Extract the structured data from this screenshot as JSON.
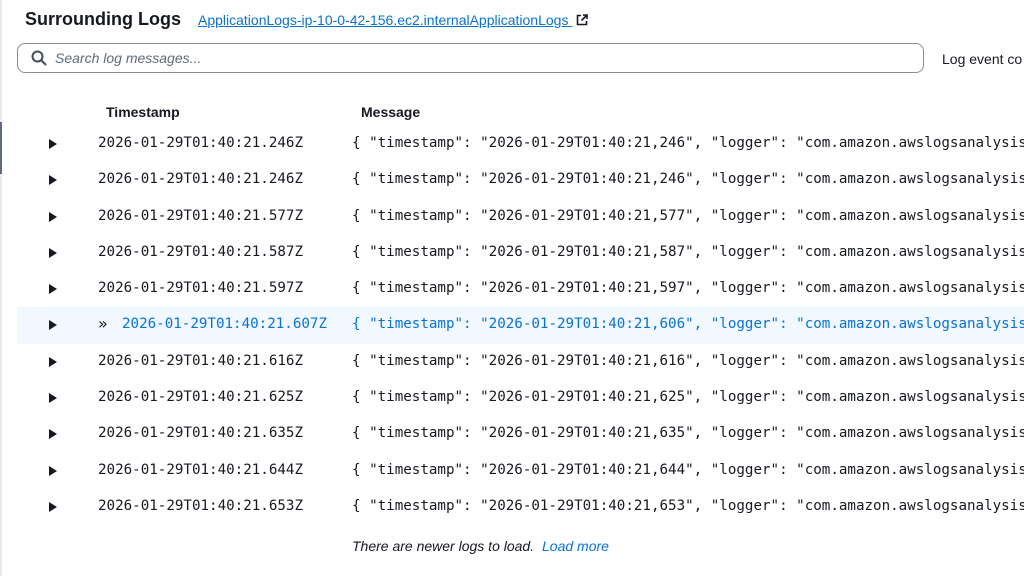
{
  "header": {
    "title": "Surrounding Logs",
    "log_group_link": "ApplicationLogs-ip-10-0-42-156.ec2.internalApplicationLogs",
    "external_icon": "external-link-icon"
  },
  "search": {
    "placeholder": "Search log messages...",
    "value": "",
    "icon": "search-icon"
  },
  "right_label": "Log event co",
  "table": {
    "columns": [
      "Timestamp",
      "Message"
    ],
    "rows": [
      {
        "timestamp": "2026-01-29T01:40:21.246Z",
        "message": "{ \"timestamp\": \"2026-01-29T01:40:21,246\", \"logger\": \"com.amazon.awslogsanalysis"
      },
      {
        "timestamp": "2026-01-29T01:40:21.246Z",
        "message": "{ \"timestamp\": \"2026-01-29T01:40:21,246\", \"logger\": \"com.amazon.awslogsanalysis"
      },
      {
        "timestamp": "2026-01-29T01:40:21.577Z",
        "message": "{ \"timestamp\": \"2026-01-29T01:40:21,577\", \"logger\": \"com.amazon.awslogsanalysis"
      },
      {
        "timestamp": "2026-01-29T01:40:21.587Z",
        "message": "{ \"timestamp\": \"2026-01-29T01:40:21,587\", \"logger\": \"com.amazon.awslogsanalysis"
      },
      {
        "timestamp": "2026-01-29T01:40:21.597Z",
        "message": "{ \"timestamp\": \"2026-01-29T01:40:21,597\", \"logger\": \"com.amazon.awslogsanalysis"
      },
      {
        "timestamp": "2026-01-29T01:40:21.607Z",
        "message": "{ \"timestamp\": \"2026-01-29T01:40:21,606\", \"logger\": \"com.amazon.awslogsanalysis",
        "selected": true,
        "marker": "»"
      },
      {
        "timestamp": "2026-01-29T01:40:21.616Z",
        "message": "{ \"timestamp\": \"2026-01-29T01:40:21,616\", \"logger\": \"com.amazon.awslogsanalysis"
      },
      {
        "timestamp": "2026-01-29T01:40:21.625Z",
        "message": "{ \"timestamp\": \"2026-01-29T01:40:21,625\", \"logger\": \"com.amazon.awslogsanalysis"
      },
      {
        "timestamp": "2026-01-29T01:40:21.635Z",
        "message": "{ \"timestamp\": \"2026-01-29T01:40:21,635\", \"logger\": \"com.amazon.awslogsanalysis"
      },
      {
        "timestamp": "2026-01-29T01:40:21.644Z",
        "message": "{ \"timestamp\": \"2026-01-29T01:40:21,644\", \"logger\": \"com.amazon.awslogsanalysis"
      },
      {
        "timestamp": "2026-01-29T01:40:21.653Z",
        "message": "{ \"timestamp\": \"2026-01-29T01:40:21,653\", \"logger\": \"com.amazon.awslogsanalysis"
      }
    ]
  },
  "footer": {
    "text": "There are newer logs to load.",
    "load_more": "Load more"
  },
  "colors": {
    "link": "#0972d3",
    "text": "#16191f",
    "selected_row_bg": "#f1f8ff",
    "border": "#8c8c94"
  }
}
